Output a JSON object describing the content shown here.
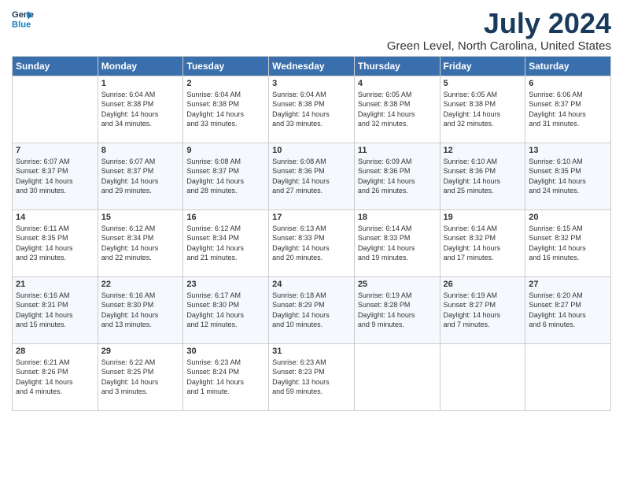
{
  "header": {
    "logo_line1": "General",
    "logo_line2": "Blue",
    "month": "July 2024",
    "location": "Green Level, North Carolina, United States"
  },
  "days_of_week": [
    "Sunday",
    "Monday",
    "Tuesday",
    "Wednesday",
    "Thursday",
    "Friday",
    "Saturday"
  ],
  "weeks": [
    [
      {
        "num": "",
        "info": ""
      },
      {
        "num": "1",
        "info": "Sunrise: 6:04 AM\nSunset: 8:38 PM\nDaylight: 14 hours\nand 34 minutes."
      },
      {
        "num": "2",
        "info": "Sunrise: 6:04 AM\nSunset: 8:38 PM\nDaylight: 14 hours\nand 33 minutes."
      },
      {
        "num": "3",
        "info": "Sunrise: 6:04 AM\nSunset: 8:38 PM\nDaylight: 14 hours\nand 33 minutes."
      },
      {
        "num": "4",
        "info": "Sunrise: 6:05 AM\nSunset: 8:38 PM\nDaylight: 14 hours\nand 32 minutes."
      },
      {
        "num": "5",
        "info": "Sunrise: 6:05 AM\nSunset: 8:38 PM\nDaylight: 14 hours\nand 32 minutes."
      },
      {
        "num": "6",
        "info": "Sunrise: 6:06 AM\nSunset: 8:37 PM\nDaylight: 14 hours\nand 31 minutes."
      }
    ],
    [
      {
        "num": "7",
        "info": "Sunrise: 6:07 AM\nSunset: 8:37 PM\nDaylight: 14 hours\nand 30 minutes."
      },
      {
        "num": "8",
        "info": "Sunrise: 6:07 AM\nSunset: 8:37 PM\nDaylight: 14 hours\nand 29 minutes."
      },
      {
        "num": "9",
        "info": "Sunrise: 6:08 AM\nSunset: 8:37 PM\nDaylight: 14 hours\nand 28 minutes."
      },
      {
        "num": "10",
        "info": "Sunrise: 6:08 AM\nSunset: 8:36 PM\nDaylight: 14 hours\nand 27 minutes."
      },
      {
        "num": "11",
        "info": "Sunrise: 6:09 AM\nSunset: 8:36 PM\nDaylight: 14 hours\nand 26 minutes."
      },
      {
        "num": "12",
        "info": "Sunrise: 6:10 AM\nSunset: 8:36 PM\nDaylight: 14 hours\nand 25 minutes."
      },
      {
        "num": "13",
        "info": "Sunrise: 6:10 AM\nSunset: 8:35 PM\nDaylight: 14 hours\nand 24 minutes."
      }
    ],
    [
      {
        "num": "14",
        "info": "Sunrise: 6:11 AM\nSunset: 8:35 PM\nDaylight: 14 hours\nand 23 minutes."
      },
      {
        "num": "15",
        "info": "Sunrise: 6:12 AM\nSunset: 8:34 PM\nDaylight: 14 hours\nand 22 minutes."
      },
      {
        "num": "16",
        "info": "Sunrise: 6:12 AM\nSunset: 8:34 PM\nDaylight: 14 hours\nand 21 minutes."
      },
      {
        "num": "17",
        "info": "Sunrise: 6:13 AM\nSunset: 8:33 PM\nDaylight: 14 hours\nand 20 minutes."
      },
      {
        "num": "18",
        "info": "Sunrise: 6:14 AM\nSunset: 8:33 PM\nDaylight: 14 hours\nand 19 minutes."
      },
      {
        "num": "19",
        "info": "Sunrise: 6:14 AM\nSunset: 8:32 PM\nDaylight: 14 hours\nand 17 minutes."
      },
      {
        "num": "20",
        "info": "Sunrise: 6:15 AM\nSunset: 8:32 PM\nDaylight: 14 hours\nand 16 minutes."
      }
    ],
    [
      {
        "num": "21",
        "info": "Sunrise: 6:16 AM\nSunset: 8:31 PM\nDaylight: 14 hours\nand 15 minutes."
      },
      {
        "num": "22",
        "info": "Sunrise: 6:16 AM\nSunset: 8:30 PM\nDaylight: 14 hours\nand 13 minutes."
      },
      {
        "num": "23",
        "info": "Sunrise: 6:17 AM\nSunset: 8:30 PM\nDaylight: 14 hours\nand 12 minutes."
      },
      {
        "num": "24",
        "info": "Sunrise: 6:18 AM\nSunset: 8:29 PM\nDaylight: 14 hours\nand 10 minutes."
      },
      {
        "num": "25",
        "info": "Sunrise: 6:19 AM\nSunset: 8:28 PM\nDaylight: 14 hours\nand 9 minutes."
      },
      {
        "num": "26",
        "info": "Sunrise: 6:19 AM\nSunset: 8:27 PM\nDaylight: 14 hours\nand 7 minutes."
      },
      {
        "num": "27",
        "info": "Sunrise: 6:20 AM\nSunset: 8:27 PM\nDaylight: 14 hours\nand 6 minutes."
      }
    ],
    [
      {
        "num": "28",
        "info": "Sunrise: 6:21 AM\nSunset: 8:26 PM\nDaylight: 14 hours\nand 4 minutes."
      },
      {
        "num": "29",
        "info": "Sunrise: 6:22 AM\nSunset: 8:25 PM\nDaylight: 14 hours\nand 3 minutes."
      },
      {
        "num": "30",
        "info": "Sunrise: 6:23 AM\nSunset: 8:24 PM\nDaylight: 14 hours\nand 1 minute."
      },
      {
        "num": "31",
        "info": "Sunrise: 6:23 AM\nSunset: 8:23 PM\nDaylight: 13 hours\nand 59 minutes."
      },
      {
        "num": "",
        "info": ""
      },
      {
        "num": "",
        "info": ""
      },
      {
        "num": "",
        "info": ""
      }
    ]
  ]
}
